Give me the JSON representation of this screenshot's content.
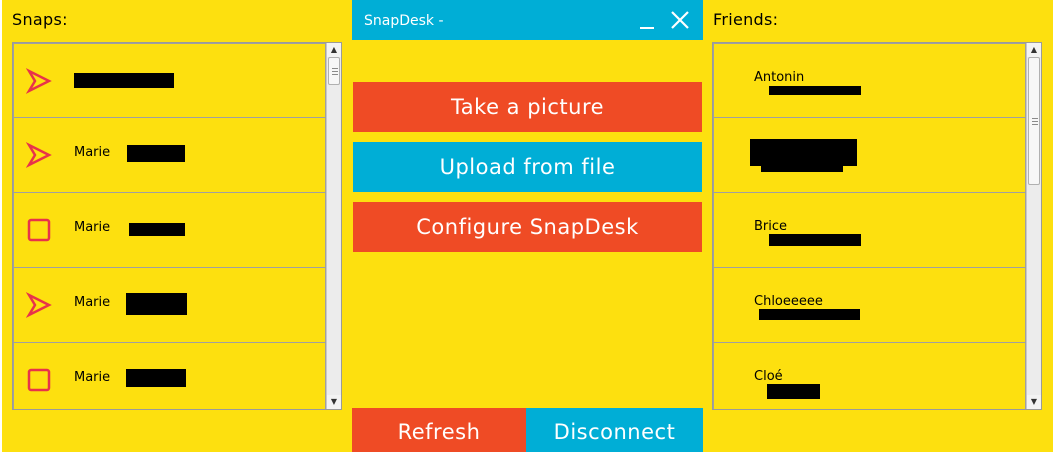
{
  "app": {
    "title": "SnapDesk -"
  },
  "snaps": {
    "heading": "Snaps:",
    "items": [
      {
        "icon": "unopened-snap-arrow-icon",
        "name": ""
      },
      {
        "icon": "unopened-snap-arrow-icon",
        "name": "Marie"
      },
      {
        "icon": "opened-snap-square-icon",
        "name": "Marie"
      },
      {
        "icon": "unopened-snap-arrow-icon",
        "name": "Marie"
      },
      {
        "icon": "opened-snap-square-icon",
        "name": "Marie"
      }
    ]
  },
  "friends": {
    "heading": "Friends:",
    "items": [
      {
        "name": "Antonin"
      },
      {
        "name": ""
      },
      {
        "name": "Brice"
      },
      {
        "name": "Chloeeeee"
      },
      {
        "name": "Cloé"
      }
    ]
  },
  "actions": {
    "take_picture": "Take a picture",
    "upload": "Upload from file",
    "configure": "Configure SnapDesk",
    "refresh": "Refresh",
    "disconnect": "Disconnect"
  },
  "colors": {
    "background": "#fde00f",
    "accent_red": "#ef4b25",
    "accent_blue": "#00aed6",
    "snap_icon": "#e8334a"
  }
}
